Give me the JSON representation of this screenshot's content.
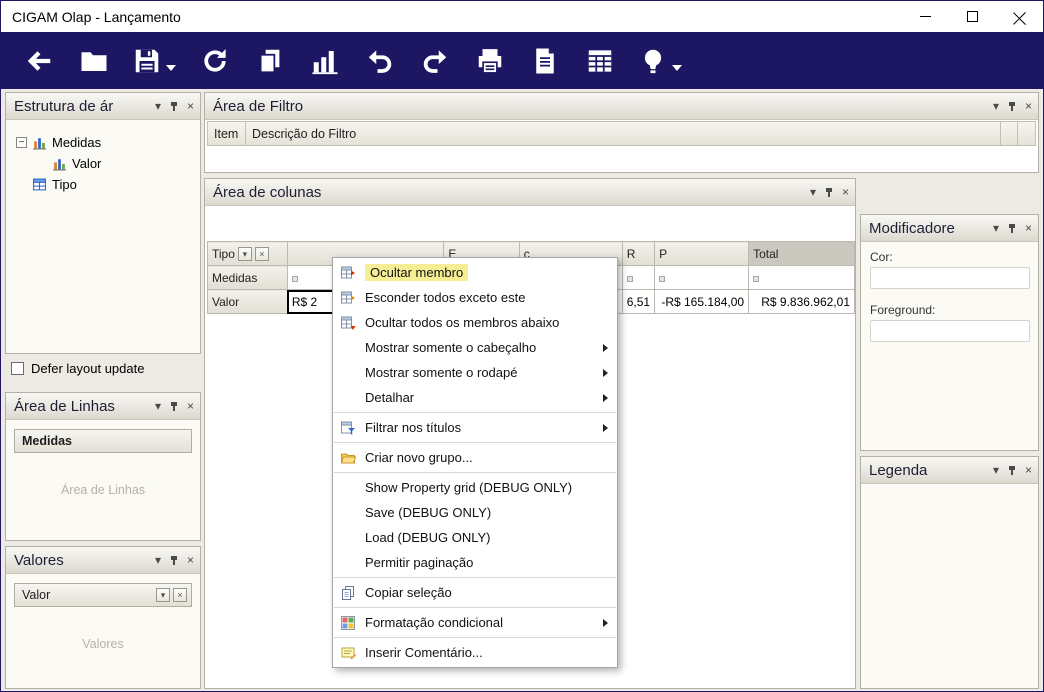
{
  "window": {
    "title": "CIGAM Olap - Lançamento"
  },
  "glyphs": {
    "caret": "▾",
    "close": "×",
    "minus": "−"
  },
  "toolbar": {
    "icons": [
      "back",
      "open-folder",
      "save",
      "refresh",
      "copy",
      "bar-chart",
      "undo",
      "redo",
      "print",
      "print-preview",
      "grid",
      "lightbulb"
    ]
  },
  "left": {
    "tree_panel": {
      "title": "Estrutura de ár"
    },
    "tree": {
      "items": [
        {
          "label": "Medidas"
        },
        {
          "label": "Valor"
        },
        {
          "label": "Tipo"
        }
      ]
    },
    "defer_label": "Defer layout update",
    "rows_panel": {
      "title": "Área de Linhas",
      "field": "Medidas",
      "placeholder": "Área de Linhas"
    },
    "values_panel": {
      "title": "Valores",
      "field": "Valor",
      "placeholder": "Valores"
    }
  },
  "filter_area": {
    "title": "Área de Filtro",
    "columns": [
      "Item",
      "Descrição do Filtro"
    ]
  },
  "columns_area": {
    "title": "Área de colunas"
  },
  "pivot": {
    "field_label": "Tipo",
    "columns": [
      "",
      "E",
      "c",
      "R",
      "P",
      "Total"
    ],
    "row_headers": [
      "Medidas",
      "Valor"
    ],
    "values": [
      "R$ 2",
      "",
      "",
      "6,51",
      "-R$ 165.184,00",
      "R$ 9.836.962,01"
    ]
  },
  "context_menu": {
    "items": [
      {
        "label": "Ocultar membro"
      },
      {
        "label": "Esconder todos exceto este"
      },
      {
        "label": "Ocultar todos os membros abaixo"
      },
      {
        "label": "Mostrar somente o cabeçalho"
      },
      {
        "label": "Mostrar somente o rodapé"
      },
      {
        "label": "Detalhar"
      },
      {
        "label": "Filtrar nos títulos"
      },
      {
        "label": "Criar novo grupo..."
      },
      {
        "label": "Show Property grid (DEBUG ONLY)"
      },
      {
        "label": "Save (DEBUG ONLY)"
      },
      {
        "label": "Load (DEBUG ONLY)"
      },
      {
        "label": "Permitir paginação"
      },
      {
        "label": "Copiar seleção"
      },
      {
        "label": "Formatação condicional"
      },
      {
        "label": "Inserir Comentário..."
      }
    ]
  },
  "right": {
    "modifier_panel": {
      "title": "Modificadore",
      "color_label": "Cor:",
      "foreground_label": "Foreground:"
    },
    "legend_panel": {
      "title": "Legenda"
    }
  }
}
